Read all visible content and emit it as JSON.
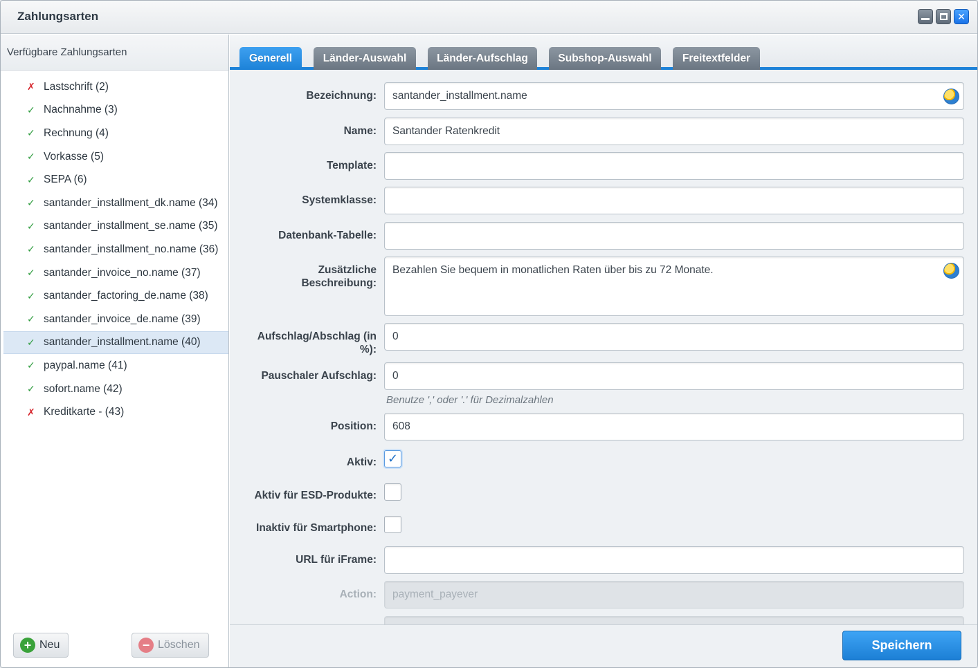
{
  "window": {
    "title": "Zahlungsarten"
  },
  "left": {
    "header": "Verfügbare Zahlungsarten",
    "items": [
      {
        "label": "Lastschrift (2)",
        "status": "✗"
      },
      {
        "label": "Nachnahme (3)",
        "status": "✓"
      },
      {
        "label": "Rechnung (4)",
        "status": "✓"
      },
      {
        "label": "Vorkasse (5)",
        "status": "✓"
      },
      {
        "label": "SEPA (6)",
        "status": "✓"
      },
      {
        "label": "santander_installment_dk.name (34)",
        "status": "✓"
      },
      {
        "label": "santander_installment_se.name (35)",
        "status": "✓"
      },
      {
        "label": "santander_installment_no.name (36)",
        "status": "✓"
      },
      {
        "label": "santander_invoice_no.name (37)",
        "status": "✓"
      },
      {
        "label": "santander_factoring_de.name (38)",
        "status": "✓"
      },
      {
        "label": "santander_invoice_de.name (39)",
        "status": "✓"
      },
      {
        "label": "santander_installment.name (40)",
        "status": "✓"
      },
      {
        "label": "paypal.name (41)",
        "status": "✓"
      },
      {
        "label": "sofort.name (42)",
        "status": "✓"
      },
      {
        "label": "Kreditkarte - (43)",
        "status": "✗"
      }
    ],
    "new_label": "Neu",
    "delete_label": "Löschen"
  },
  "tabs": [
    "Generell",
    "Länder-Auswahl",
    "Länder-Aufschlag",
    "Subshop-Auswahl",
    "Freitextfelder"
  ],
  "form": {
    "bezeichnung": {
      "label": "Bezeichnung:",
      "value": "santander_installment.name"
    },
    "name": {
      "label": "Name:",
      "value": "Santander Ratenkredit"
    },
    "template": {
      "label": "Template:",
      "value": ""
    },
    "systemklasse": {
      "label": "Systemklasse:",
      "value": ""
    },
    "datenbank": {
      "label": "Datenbank-Tabelle:",
      "value": ""
    },
    "beschreibung": {
      "label_line1": "Zusätzliche",
      "label_line2": "Beschreibung:",
      "value": "Bezahlen Sie bequem in monatlichen Raten über bis zu 72 Monate."
    },
    "aufschlag": {
      "label_line1": "Aufschlag/Abschlag (in",
      "label_line2": "%):",
      "value": "0"
    },
    "pauschal": {
      "label": "Pauschaler Aufschlag:",
      "value": "0",
      "hint": "Benutze ',' oder '.' für Dezimalzahlen"
    },
    "position": {
      "label": "Position:",
      "value": "608"
    },
    "aktiv": {
      "label": "Aktiv:",
      "check": "✓"
    },
    "esd": {
      "label": "Aktiv für ESD-Produkte:",
      "check": ""
    },
    "smartphone": {
      "label": "Inaktiv für Smartphone:",
      "check": ""
    },
    "iframe": {
      "label": "URL für iFrame:",
      "value": ""
    },
    "action": {
      "label": "Action:",
      "value": "payment_payever"
    }
  },
  "footer": {
    "save_label": "Speichern"
  },
  "icons": {
    "minimize": "minimize-icon",
    "maximize": "maximize-icon",
    "close": "close-icon",
    "check": "check-icon",
    "cross": "cross-icon",
    "globe": "translation-globe-icon",
    "plus": "plus-icon",
    "minus": "minus-icon"
  },
  "colors": {
    "accent": "#1d82d8",
    "ok": "#2e9c3e",
    "error": "#d6262d",
    "selected_row": "#dce8f5"
  }
}
